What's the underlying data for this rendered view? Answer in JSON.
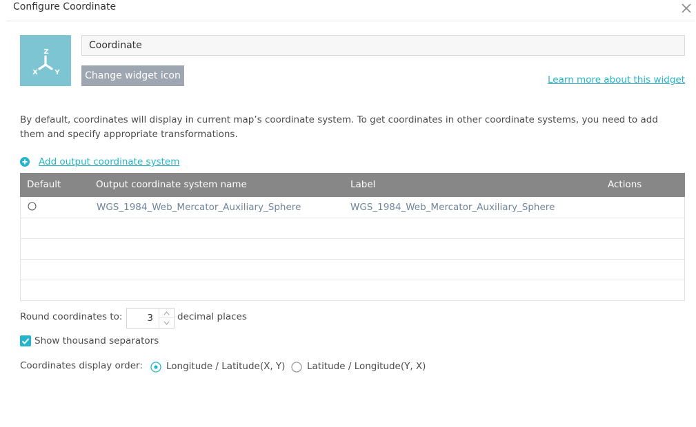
{
  "dialog": {
    "title": "Configure Coordinate"
  },
  "widget": {
    "icon_labels": {
      "z": "Z",
      "x": "X",
      "y": "Y"
    },
    "icon_color": "#7ec5d4",
    "name_value": "Coordinate",
    "change_icon_label": "Change widget icon",
    "learn_more_label": "Learn more about this widget"
  },
  "description": "By default, coordinates will display in current map’s coordinate system. To get coordinates in other coordinate systems, you need to add them and specify appropriate transformations.",
  "add_output_label": "Add output coordinate system",
  "table": {
    "headers": {
      "default": "Default",
      "name": "Output coordinate system name",
      "label": "Label",
      "actions": "Actions"
    },
    "rows": [
      {
        "default_selected": false,
        "name": "WGS_1984_Web_Mercator_Auxiliary_Sphere",
        "label": "WGS_1984_Web_Mercator_Auxiliary_Sphere"
      }
    ]
  },
  "round": {
    "label": "Round coordinates to:",
    "value": "3",
    "suffix": "decimal places"
  },
  "thousand_separators": {
    "label": "Show thousand separators",
    "checked": true
  },
  "display_order": {
    "label": "Coordinates display order:",
    "options": [
      {
        "label": "Longitude / Latitude(X, Y)",
        "selected": true
      },
      {
        "label": "Latitude / Longitude(Y, X)",
        "selected": false
      }
    ]
  },
  "colors": {
    "accent": "#24b5cc",
    "header_bg": "#878787",
    "button_bg": "#9ea6b1",
    "cell_text": "#6e86a0"
  }
}
